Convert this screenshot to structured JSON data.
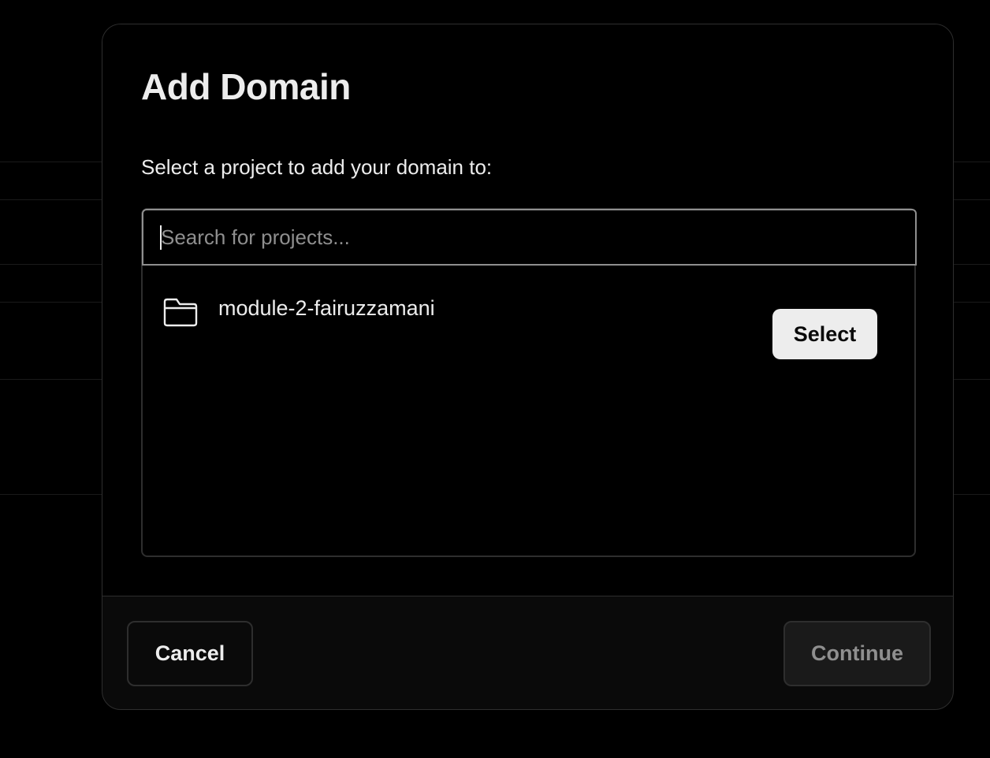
{
  "dialog": {
    "title": "Add Domain",
    "subtitle": "Select a project to add your domain to:"
  },
  "search": {
    "placeholder": "Search for projects...",
    "value": ""
  },
  "projects": [
    {
      "name": "module-2-fairuzzamani",
      "icon": "folder-icon",
      "action_label": "Select"
    }
  ],
  "footer": {
    "cancel_label": "Cancel",
    "continue_label": "Continue",
    "continue_enabled": false
  },
  "colors": {
    "background": "#000000",
    "modal_footer": "#0a0a0a",
    "border": "#2e2e2e",
    "text": "#ededed",
    "muted_text": "#8f8f8f",
    "select_button_bg": "#ededed"
  }
}
